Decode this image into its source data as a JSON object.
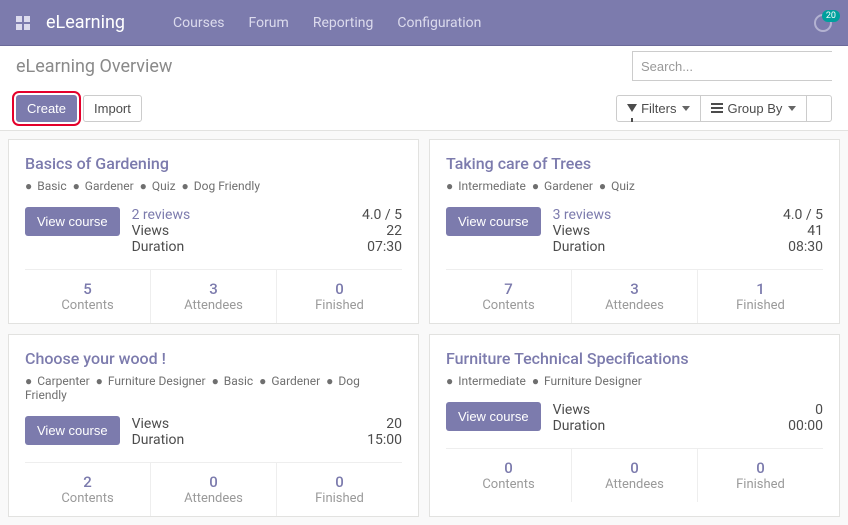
{
  "navbar": {
    "brand": "eLearning",
    "items": [
      "Courses",
      "Forum",
      "Reporting",
      "Configuration"
    ],
    "badge_count": "20"
  },
  "breadcrumb": "eLearning Overview",
  "search": {
    "placeholder": "Search..."
  },
  "toolbar": {
    "create": "Create",
    "import": "Import",
    "filters": "Filters",
    "groupby": "Group By"
  },
  "labels": {
    "view_course": "View course",
    "views": "Views",
    "duration": "Duration",
    "contents": "Contents",
    "attendees": "Attendees",
    "finished": "Finished"
  },
  "cards": [
    {
      "title": "Basics of Gardening",
      "tags": [
        "Basic",
        "Gardener",
        "Quiz",
        "Dog Friendly"
      ],
      "reviews": "2 reviews",
      "rating": "4.0 / 5",
      "views": "22",
      "duration": "07:30",
      "contents": "5",
      "attendees": "3",
      "finished": "0"
    },
    {
      "title": "Taking care of Trees",
      "tags": [
        "Intermediate",
        "Gardener",
        "Quiz"
      ],
      "reviews": "3 reviews",
      "rating": "4.0 / 5",
      "views": "41",
      "duration": "08:30",
      "contents": "7",
      "attendees": "3",
      "finished": "1"
    },
    {
      "title": "Choose your wood !",
      "tags": [
        "Carpenter",
        "Furniture Designer",
        "Basic",
        "Gardener",
        "Dog Friendly"
      ],
      "reviews": null,
      "rating": null,
      "views": "20",
      "duration": "15:00",
      "contents": "2",
      "attendees": "0",
      "finished": "0"
    },
    {
      "title": "Furniture Technical Specifications",
      "tags": [
        "Intermediate",
        "Furniture Designer"
      ],
      "reviews": null,
      "rating": null,
      "views": "0",
      "duration": "00:00",
      "contents": "0",
      "attendees": "0",
      "finished": "0"
    }
  ]
}
